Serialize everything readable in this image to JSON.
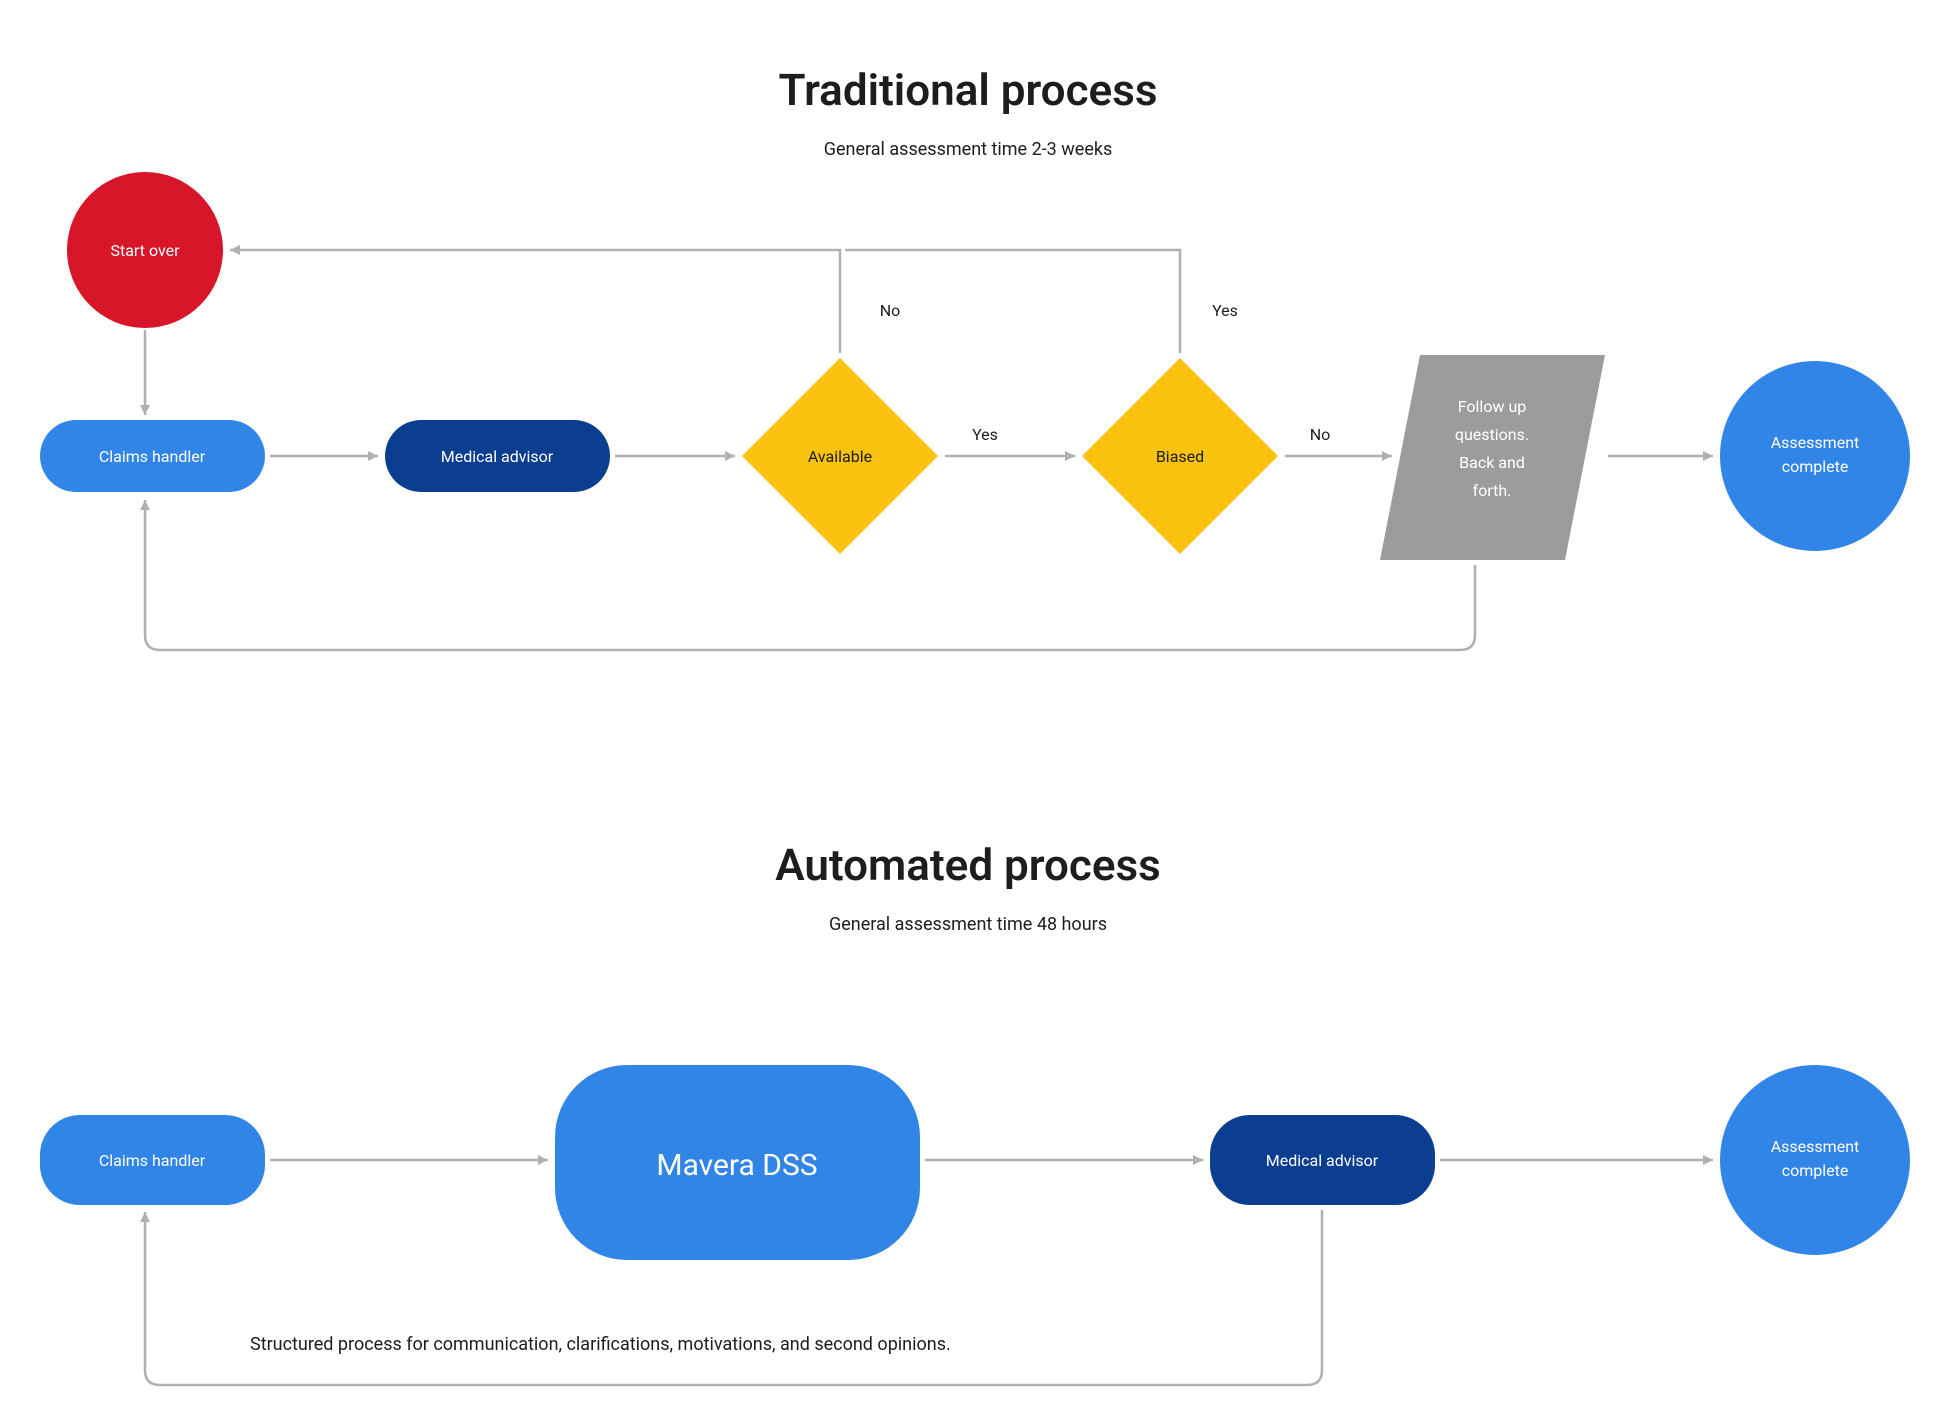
{
  "traditional": {
    "title": "Traditional process",
    "subtitle": "General assessment time 2-3 weeks",
    "nodes": {
      "start_over": "Start over",
      "claims_handler": "Claims handler",
      "medical_advisor": "Medical advisor",
      "available": "Available",
      "biased": "Biased",
      "follow_up": "Follow up questions. Back and forth.",
      "assessment_complete": "Assessment complete"
    },
    "edge_labels": {
      "available_no": "No",
      "available_yes": "Yes",
      "biased_yes": "Yes",
      "biased_no": "No"
    }
  },
  "automated": {
    "title": "Automated process",
    "subtitle": "General assessment time 48 hours",
    "nodes": {
      "claims_handler": "Claims handler",
      "mavera_dss": "Mavera DSS",
      "medical_advisor": "Medical advisor",
      "assessment_complete": "Assessment complete"
    },
    "caption": "Structured process for communication, clarifications, motivations, and second opinions."
  },
  "colors": {
    "blue": "#3185e6",
    "darkblue": "#0b3d91",
    "red": "#d7162a",
    "yellow": "#f8c20f",
    "gray": "#9c9c9c",
    "arrow": "#b0b0b0"
  }
}
